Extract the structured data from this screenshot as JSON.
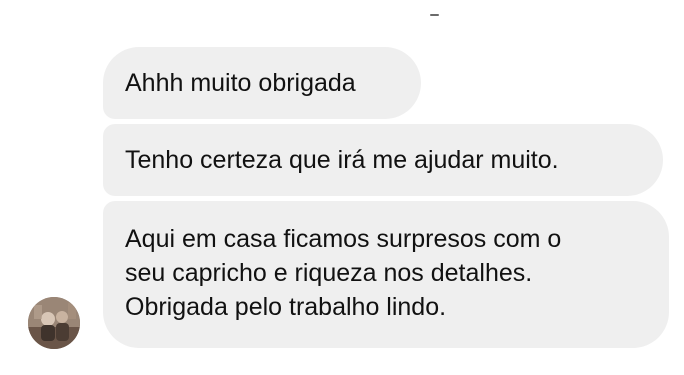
{
  "conversation": {
    "messages": [
      {
        "lines": [
          "Ahhh muito obrigada"
        ]
      },
      {
        "lines": [
          "Tenho certeza que irá me ajudar muito."
        ]
      },
      {
        "lines": [
          "Aqui em casa ficamos surpresos com o",
          "seu capricho e riqueza nos detalhes.",
          "Obrigada pelo trabalho lindo."
        ]
      }
    ],
    "sender": {
      "avatar_icon": "user-photo-icon"
    }
  },
  "colors": {
    "bubble_background": "#efefef",
    "text": "#111111",
    "background": "#ffffff"
  }
}
